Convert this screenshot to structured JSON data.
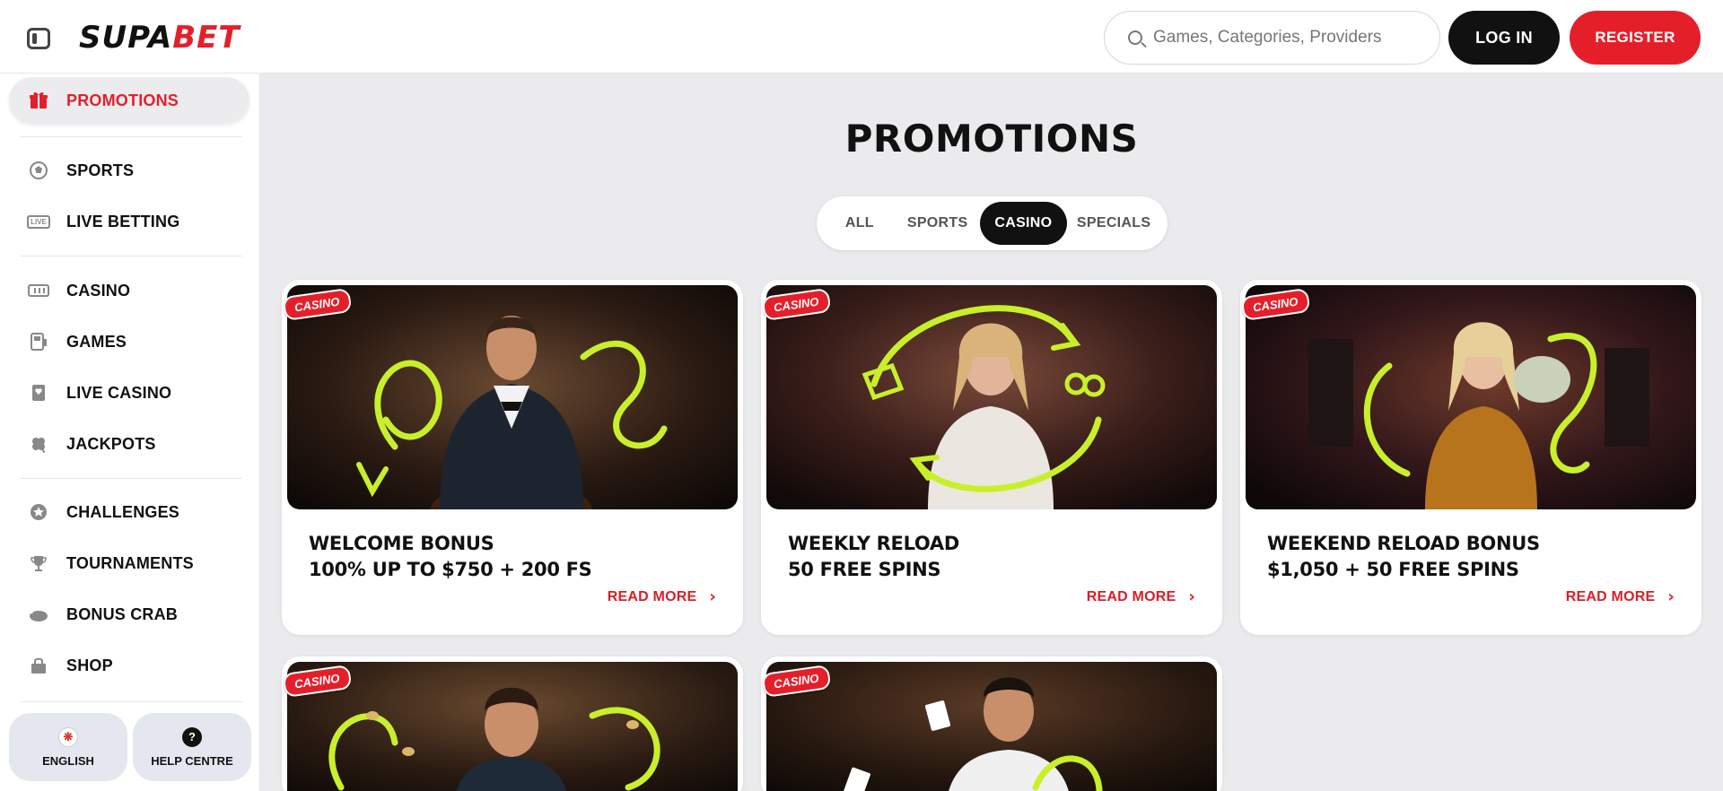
{
  "header": {
    "logo_supa": "SUPA",
    "logo_bet": "BET",
    "search_placeholder": "Games, Categories, Providers",
    "login_label": "LOG IN",
    "register_label": "REGISTER"
  },
  "sidebar": {
    "items": [
      {
        "label": "PROMOTIONS",
        "icon": "gift-icon"
      },
      {
        "label": "SPORTS",
        "icon": "soccer-ball-icon"
      },
      {
        "label": "LIVE BETTING",
        "icon": "live-icon"
      },
      {
        "label": "CASINO",
        "icon": "slot-machine-icon"
      },
      {
        "label": "GAMES",
        "icon": "arcade-icon"
      },
      {
        "label": "LIVE CASINO",
        "icon": "playing-card-icon"
      },
      {
        "label": "JACKPOTS",
        "icon": "clover-icon"
      },
      {
        "label": "CHALLENGES",
        "icon": "star-badge-icon"
      },
      {
        "label": "TOURNAMENTS",
        "icon": "trophy-icon"
      },
      {
        "label": "BONUS CRAB",
        "icon": "crab-icon"
      },
      {
        "label": "SHOP",
        "icon": "shopping-bag-icon"
      }
    ],
    "language_label": "ENGLISH",
    "help_label": "HELP CENTRE",
    "help_icon_glyph": "?"
  },
  "main": {
    "title": "PROMOTIONS",
    "tabs": [
      {
        "label": "ALL"
      },
      {
        "label": "SPORTS"
      },
      {
        "label": "CASINO",
        "active": true
      },
      {
        "label": "SPECIALS"
      }
    ],
    "cards": [
      {
        "badge": "CASINO",
        "title_line1": "WELCOME BONUS",
        "title_line2": "100% UP TO $750 + 200 FS",
        "read_more": "READ MORE"
      },
      {
        "badge": "CASINO",
        "title_line1": "WEEKLY RELOAD",
        "title_line2": "50 FREE SPINS",
        "read_more": "READ MORE"
      },
      {
        "badge": "CASINO",
        "title_line1": "WEEKEND RELOAD BONUS",
        "title_line2": "$1,050 + 50 FREE SPINS",
        "read_more": "READ MORE"
      },
      {
        "badge": "CASINO"
      },
      {
        "badge": "CASINO"
      }
    ]
  },
  "colors": {
    "brand_red": "#e51f2a",
    "dark": "#111111",
    "accent_green": "#c8f02a"
  }
}
